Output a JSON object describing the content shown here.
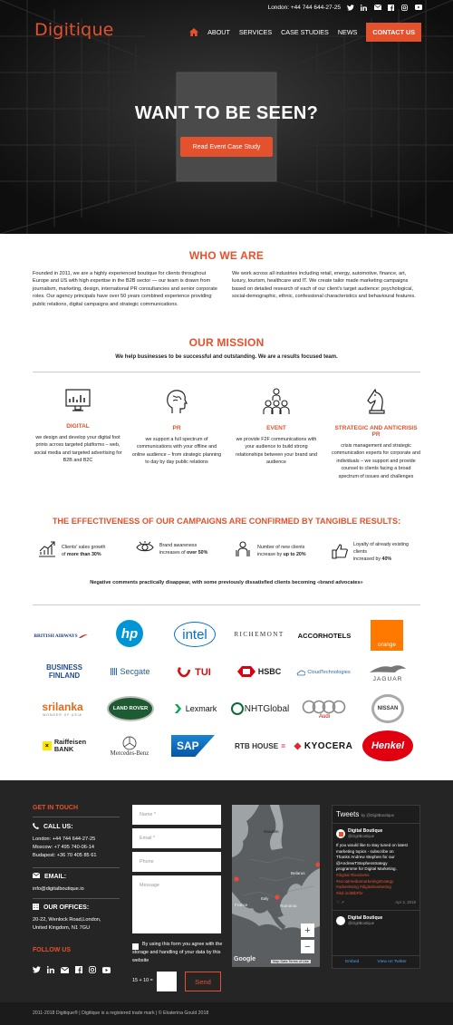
{
  "header": {
    "phone": "London: +44 744 644-27-25",
    "logo": "Digitique",
    "nav": [
      "ABOUT",
      "SERVICES",
      "CASE STUDIES",
      "NEWS"
    ],
    "contact": "CONTACT US"
  },
  "hero": {
    "title": "WANT TO BE SEEN?",
    "button": "Read Event Case Study"
  },
  "who": {
    "title": "WHO WE ARE",
    "left": "Founded in 2011, we are a highly experienced boutique for clients throughout Europe and US with high expertise in the B2B sector — our team is drawn from journalism, marketing, design, international PR consultancies and senior corporate roles. Our agency principals have over 50 years combined experience providing public relations, digital campaigns and strategic communications.",
    "right": "We work across all industries including retail, energy, automotive, finance, art, luxury, tourism, healthcare and IT. We create tailor made marketing campaigns based on detailed research of each of our client's target audience: psychological, social-demographic, ethnic, confessional characteristics and behavioural features."
  },
  "mission": {
    "title": "OUR MISSION",
    "subtitle": "We help businesses to be successful and outstanding. We are a results focused team.",
    "pillars": [
      {
        "title": "DIGITAL",
        "text": "we design and develop your digital foot prints across targeted platforms – web, social media and targeted advertising for B2B and B2C"
      },
      {
        "title": "PR",
        "text": "we support a full spectrum of communications with your offline and online audience – from strategic planning to day by day public relations"
      },
      {
        "title": "EVENT",
        "text": "we provide F2F communications with your audience to build strong relationships between your brand and audience"
      },
      {
        "title": "STRATEGIC AND ANTICRISIS PR",
        "text": "crisis management and strategic communication experts for corporate and individuals – we support and provide counsel to clients facing a broad spectrum of issues and challenges"
      }
    ]
  },
  "effect": {
    "title": "THE EFFECTIVENESS OF OUR CAMPAIGNS ARE CONFIRMED BY TANGIBLE RESULTS:",
    "stats": [
      {
        "line1": "Clients' sales growth",
        "line2a": "of ",
        "bold": "more than 30%",
        "line2b": ""
      },
      {
        "line1": "Brand awareness",
        "line2a": "increases of ",
        "bold": "over 50%",
        "line2b": ""
      },
      {
        "line1": "Number of new clients",
        "line2a": "increase by ",
        "bold": "up to 20%",
        "line2b": ""
      },
      {
        "line1": "Loyalty of already existing clients",
        "line2a": "increased by ",
        "bold": "40%",
        "line2b": ""
      }
    ],
    "note": "Negative comments practically disappear, with some previously dissatisfied clients becoming «brand advocates»"
  },
  "logos": {
    "british": "BRITISH AIRWAYS",
    "hp": "hp",
    "intel": "intel",
    "richemont": "RICHEMONT",
    "accor": "ACCORHOTELS",
    "orange": "orange",
    "bf1": "BUSINESS",
    "bf2": "FINLAND",
    "secgate": "Secgate",
    "tui": "TUI",
    "hsbc": "HSBC",
    "cloud": "CloudTechnologies",
    "jaguar": "JAGUAR",
    "srilanka": "srilanka",
    "srilanka_sub": "WONDER OF ASIA",
    "landrover": "LAND ROVER",
    "lexmark": "Lexmark",
    "nht": "NHTGlobal",
    "audi": "Audi",
    "nissan": "NISSAN",
    "raif1": "Raiffeisen",
    "raif2": "BANK",
    "mercedes": "Mercedes-Benz",
    "sap": "SAP",
    "rtb": "RTB HOUSE",
    "kyocera": "KYOCERA",
    "henkel": "Henkel"
  },
  "footer": {
    "get_in_touch": "GET IN TOUCH",
    "call": "CALL US:",
    "phones": [
      "London: +44 744 644-27-25",
      "Moscow: +7 495 740-06-14",
      "Budapest: +36 70 405 85 61"
    ],
    "email_h": "EMAIL:",
    "email": "info@digitalboutique.io",
    "office_h": "OUR OFFICES:",
    "office": [
      "20-22, Wenlock Road,London,",
      "United Kingdom, N1 7GU"
    ],
    "follow": "FOLLOW US",
    "form": {
      "name": "Name *",
      "email": "Email *",
      "phone": "Phone",
      "message": "Message",
      "consent": "By using this form you agree with the storage and handling of your data by this website",
      "captcha": "15 + 10 =",
      "send": "Send"
    },
    "map": {
      "sweden": "Sweden",
      "belarus": "Belarus",
      "france": "France",
      "italy": "Italy",
      "romania": "Romania",
      "google": "Google",
      "mapdata": "Map Data",
      "terms": "Terms of Use",
      "plus": "+",
      "minus": "−"
    },
    "tweets": {
      "title": "Tweets",
      "by": "by @DigitBoutique",
      "name": "Digital Boutique",
      "handle": "@DigitBoutique",
      "body": "If you would like to stay tuned on latest marketing topics - subscribe on",
      "thanks": "Thanks Andrew Stephen for our",
      "mention": "@AndrewTStephenstrategy",
      "body2": "programme for Digital Marketing.",
      "tags": [
        "#digital #business",
        "#socialmediamarketingstrategy",
        "#advertising #digitalmarketing",
        "#ikd.in/dBbFbr"
      ],
      "date": "Apr 2, 2019",
      "name2": "Digital Boutique",
      "handle2": "@DigitBoutique",
      "embed": "Embed",
      "view": "View on Twitter"
    }
  },
  "copyright": "2011-2018 Digitique® | Digitique is a registered trade mark | © Ekaterina Gould 2018"
}
